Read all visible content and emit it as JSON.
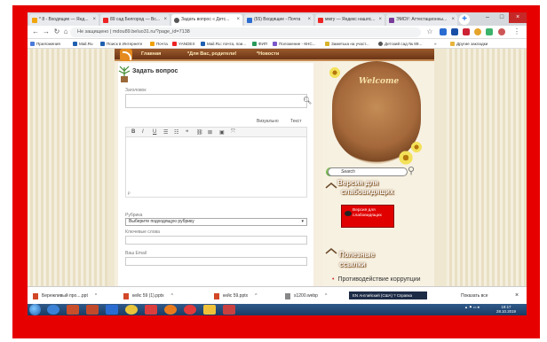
{
  "browser": {
    "tabs": [
      {
        "label": "* 8 - Входящие — Янд..."
      },
      {
        "label": "89 сад Белгород — Вс..."
      },
      {
        "label": "Задать вопрос « Детс..."
      },
      {
        "label": "(55) Входящие - Почта"
      },
      {
        "label": "ммгу — Яндекс нашлс..."
      },
      {
        "label": "ЭМОУ: Аттестационны..."
      }
    ],
    "url": "Не защищено | mdou89.beluo31.ru/?page_id=7138",
    "bookmarks": [
      "Приложения",
      "Mail.Ru",
      "Поиск в Интернете",
      "Почта",
      "YANDEX",
      "Mail.Ru: почта, пои...",
      "ФИП",
      "Положение - КНС...",
      "Заметька на участ...",
      "Детский сад № 89...",
      "»",
      "Другие закладки"
    ]
  },
  "site": {
    "nav": [
      "Главная",
      "*Для Вас, родители!",
      "*Новости"
    ],
    "content": {
      "title": "Задать вопрос",
      "heading_label": "Заголовок",
      "tab_visual": "Визуально",
      "tab_text": "Текст",
      "editor_path": "p",
      "category_label": "Рубрика",
      "category_value": "Выберите подходящую рубрику",
      "keywords_label": "Ключевые слова",
      "email_label": "Ваш Email"
    },
    "sidebar": {
      "welcome": "Welcome",
      "search_value": "Search",
      "vision_title_1": "Версия для",
      "vision_title_2": "слабовидящих",
      "vision_button": "Версия для слабовидящих",
      "links_title_1": "Полезные",
      "links_title_2": "ссылки",
      "links_item": "Противодействие коррупции"
    }
  },
  "downloads": {
    "items": [
      "Бережливый про....ppt",
      "кейс 59 (1).pptx",
      "кейс 59.pptx",
      "s1200.webp"
    ],
    "show_all": "Показать все",
    "ime": "EN Английский (США) ? Справка"
  },
  "taskbar": {
    "time": "19:17",
    "date": "28.10.2019"
  },
  "colors": {
    "frame": "#e60000",
    "nav": "#7b4020",
    "vision_button": "#e00000"
  }
}
